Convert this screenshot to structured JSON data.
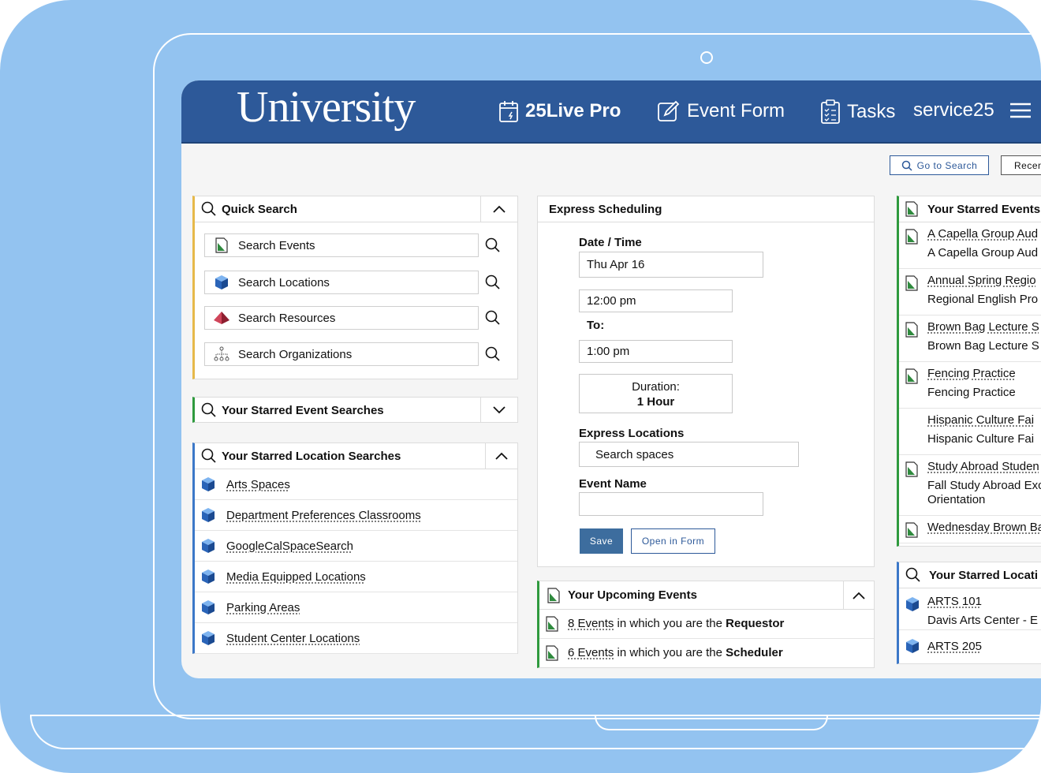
{
  "header": {
    "logo": "University",
    "app_name": "25Live Pro",
    "event_form": "Event Form",
    "tasks": "Tasks",
    "user": "service25"
  },
  "toolbar": {
    "go_to_search": "Go to Search",
    "recent": "Recen"
  },
  "quick_search": {
    "title": "Quick Search",
    "items": [
      {
        "label": "Search Events",
        "icon": "event-icon"
      },
      {
        "label": "Search Locations",
        "icon": "location-cube-icon"
      },
      {
        "label": "Search Resources",
        "icon": "resource-pyramid-icon"
      },
      {
        "label": "Search Organizations",
        "icon": "organization-icon"
      }
    ]
  },
  "starred_event_searches": {
    "title": "Your Starred Event Searches"
  },
  "starred_location_searches": {
    "title": "Your Starred Location Searches",
    "items": [
      "Arts Spaces",
      "Department Preferences Classrooms",
      "GoogleCalSpaceSearch",
      "Media Equipped Locations",
      "Parking Areas",
      "Student Center Locations"
    ]
  },
  "express": {
    "title": "Express Scheduling",
    "date_time_label": "Date / Time",
    "date": "Thu Apr 16",
    "start_time": "12:00 pm",
    "to_label": "To:",
    "end_time": "1:00 pm",
    "duration_label": "Duration:",
    "duration_value": "1 Hour",
    "locations_label": "Express Locations",
    "locations_placeholder": "Search spaces",
    "event_name_label": "Event Name",
    "event_name_value": "",
    "save": "Save",
    "open_in_form": "Open in Form"
  },
  "upcoming": {
    "title": "Your Upcoming Events",
    "rows": [
      {
        "count": "8 Events",
        "middle": "in which you are the",
        "role": "Requestor"
      },
      {
        "count": "6 Events",
        "middle": "in which you are the",
        "role": "Scheduler"
      }
    ]
  },
  "starred_events": {
    "title": "Your Starred Events",
    "rows": [
      {
        "name": "A Capella Group Aud",
        "sub": "A Capella Group Aud",
        "icon": true
      },
      {
        "name": "Annual Spring Regio",
        "sub": "Regional English Pro",
        "icon": true
      },
      {
        "name": "Brown Bag Lecture S",
        "sub": "Brown Bag Lecture S",
        "icon": true
      },
      {
        "name": "Fencing Practice",
        "sub": "Fencing Practice",
        "icon": true
      },
      {
        "name": "Hispanic Culture Fai",
        "sub": "Hispanic Culture Fai",
        "icon": false
      },
      {
        "name": "Study Abroad Studen",
        "sub": "Fall Study Abroad Exc",
        "sub2": "Orientation",
        "icon": true
      },
      {
        "name": "Wednesday Brown Ba",
        "sub": "",
        "icon": true
      }
    ]
  },
  "starred_locations": {
    "title": "Your Starred Locati",
    "rows": [
      {
        "name": "ARTS 101",
        "sub": "Davis Arts Center - E"
      },
      {
        "name": "ARTS 205",
        "sub": ""
      }
    ]
  },
  "colors": {
    "background": "#93c3f0",
    "header": "#2d5999",
    "quick_search_accent": "#e6b94a",
    "events_accent": "#2f9a3e",
    "locations_accent": "#3c78c8",
    "save_button": "#3d6d9e"
  }
}
